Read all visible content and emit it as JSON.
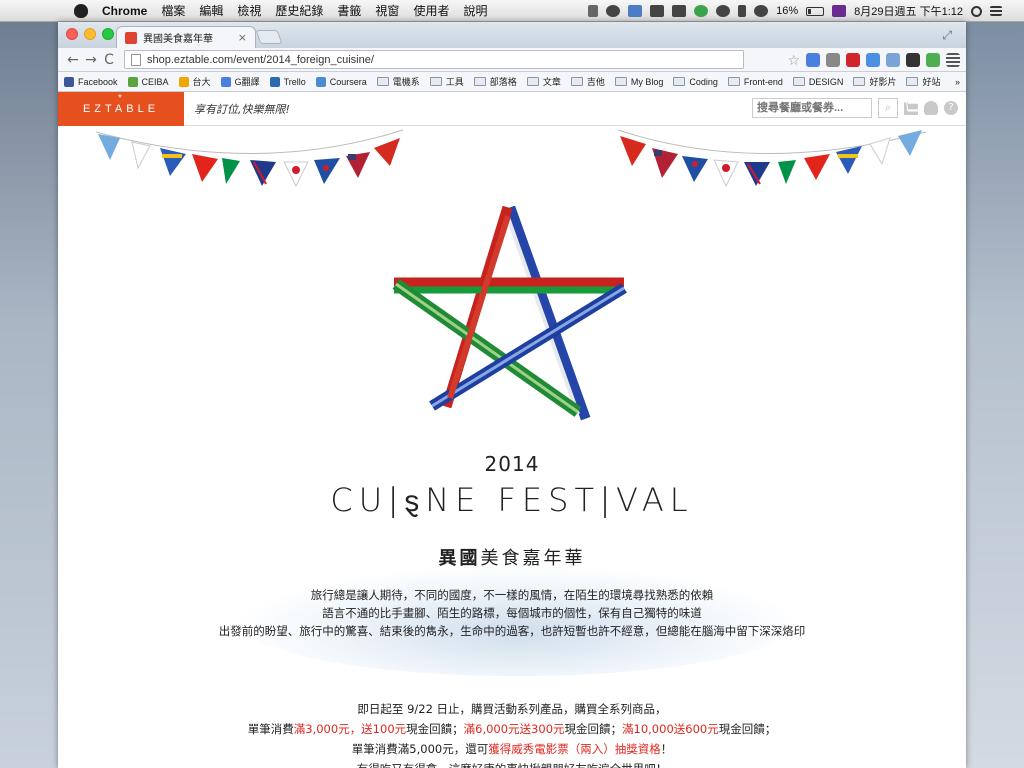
{
  "menubar": {
    "app_name": "Chrome",
    "items": [
      "檔案",
      "編輯",
      "檢視",
      "歷史紀錄",
      "書籤",
      "視窗",
      "使用者",
      "說明"
    ],
    "battery": "16%",
    "datetime": "8月29日週五 下午1:12"
  },
  "browser": {
    "tab_title": "異國美食嘉年華",
    "tab_close": "×",
    "url": "shop.eztable.com/event/2014_foreign_cuisine/",
    "bookmarks": [
      {
        "label": "Facebook",
        "icon": "facebook-icon",
        "color": "#3b5998"
      },
      {
        "label": "CEIBA",
        "icon": "ceiba-icon",
        "color": "#5aa33d"
      },
      {
        "label": "台大",
        "icon": "ntu-icon",
        "color": "#f0a500"
      },
      {
        "label": "G翻譯",
        "icon": "google-translate-icon",
        "color": "#4a7fe0"
      },
      {
        "label": "Trello",
        "icon": "trello-icon",
        "color": "#2b6ab1"
      },
      {
        "label": "Coursera",
        "icon": "coursera-icon",
        "color": "#4b8bd0"
      },
      {
        "label": "電機系",
        "icon": "folder-icon"
      },
      {
        "label": "工具",
        "icon": "folder-icon"
      },
      {
        "label": "部落格",
        "icon": "folder-icon"
      },
      {
        "label": "文章",
        "icon": "folder-icon"
      },
      {
        "label": "吉他",
        "icon": "folder-icon"
      },
      {
        "label": "My Blog",
        "icon": "folder-icon"
      },
      {
        "label": "Coding",
        "icon": "folder-icon"
      },
      {
        "label": "Front-end",
        "icon": "folder-icon"
      },
      {
        "label": "DESIGN",
        "icon": "folder-icon"
      },
      {
        "label": "好影片",
        "icon": "folder-icon"
      },
      {
        "label": "好站",
        "icon": "folder-icon"
      }
    ],
    "more": "»"
  },
  "site": {
    "logo": "EZTABLE",
    "slogan": "享有訂位,快樂無限!",
    "search_placeholder": "搜尋餐廳或餐券..."
  },
  "event": {
    "year": "2014",
    "title_left": "CU",
    "title_right": "NE FEST",
    "title_end": "VAL",
    "subtitle_bold": "異國",
    "subtitle_rest": "美食嘉年華",
    "intro": [
      "旅行總是讓人期待，不同的國度，不一樣的風情，在陌生的環境尋找熟悉的依賴",
      "語言不通的比手畫腳、陌生的路標，每個城市的個性，保有自己獨特的味道",
      "出發前的盼望、旅行中的驚喜、結束後的雋永，生命中的過客，也許短暫也許不經意，但總能在腦海中留下深深烙印"
    ],
    "promo": {
      "line1": "即日起至 9/22 日止，購買活動系列產品，購買全系列商品，",
      "line2_a": "單筆消費",
      "line2_b": "滿3,000元，送100元",
      "line2_c": "現金回饋；",
      "line2_d": "滿6,000元送300元",
      "line2_e": "現金回饋；",
      "line2_f": "滿10,000送600元",
      "line2_g": "現金回饋；",
      "line3_a": "單筆消費滿5,000元，還可",
      "line3_b": "獲得威秀電影票（兩入）抽獎資格",
      "line3_c": "！",
      "line4": "有得吃又有得拿，這麼好康的事快揪親朋好友吃遍全世界吧！"
    }
  },
  "colors": {
    "brand": "#e5501e",
    "highlight": "#e0281f"
  }
}
